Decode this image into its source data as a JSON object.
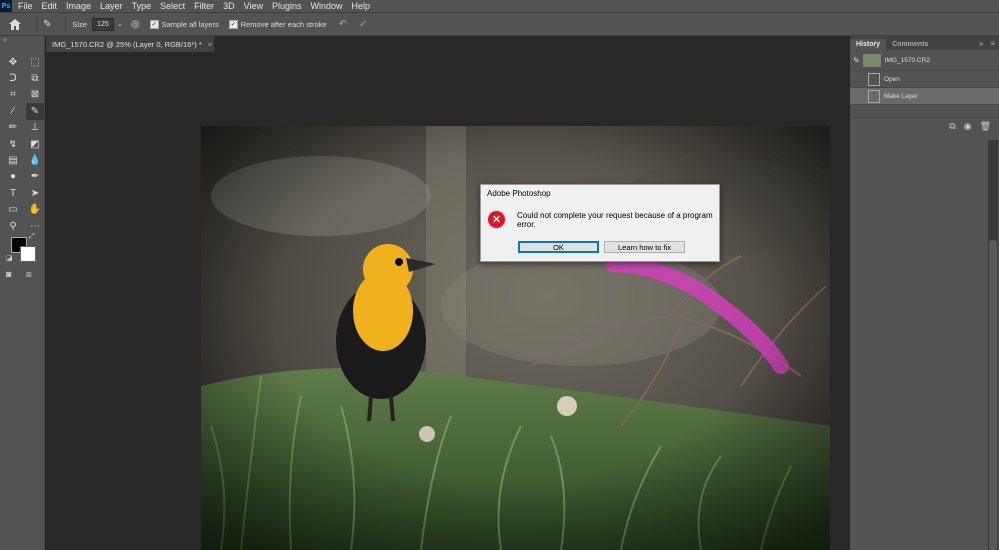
{
  "menubar": {
    "logo": "Ps",
    "items": [
      "File",
      "Edit",
      "Image",
      "Layer",
      "Type",
      "Select",
      "Filter",
      "3D",
      "View",
      "Plugins",
      "Window",
      "Help"
    ]
  },
  "options": {
    "size_label": "Size",
    "size_value": "125",
    "sample_all_layers": "Sample all layers",
    "remove_after_stroke": "Remove after each stroke"
  },
  "document_tab": {
    "title": "IMG_1570.CR2 @ 25% (Layer 0, RGB/16*) *",
    "close": "×"
  },
  "history_panel": {
    "tabs": [
      "History",
      "Comments"
    ],
    "snapshot": "IMG_1570.CR2",
    "states": [
      "Open",
      "Make Layer"
    ]
  },
  "dialog": {
    "title": "Adobe Photoshop",
    "icon": "✕",
    "message": "Could not complete your request because of a program error.",
    "ok_label": "OK",
    "learn_label": "Learn how to fix"
  },
  "colors": {
    "ui_dark": "#282828",
    "ui_panel": "#535353",
    "error_red": "#e81123",
    "brush_stroke": "#d63fbf",
    "bird_yellow": "#f0b21c"
  }
}
